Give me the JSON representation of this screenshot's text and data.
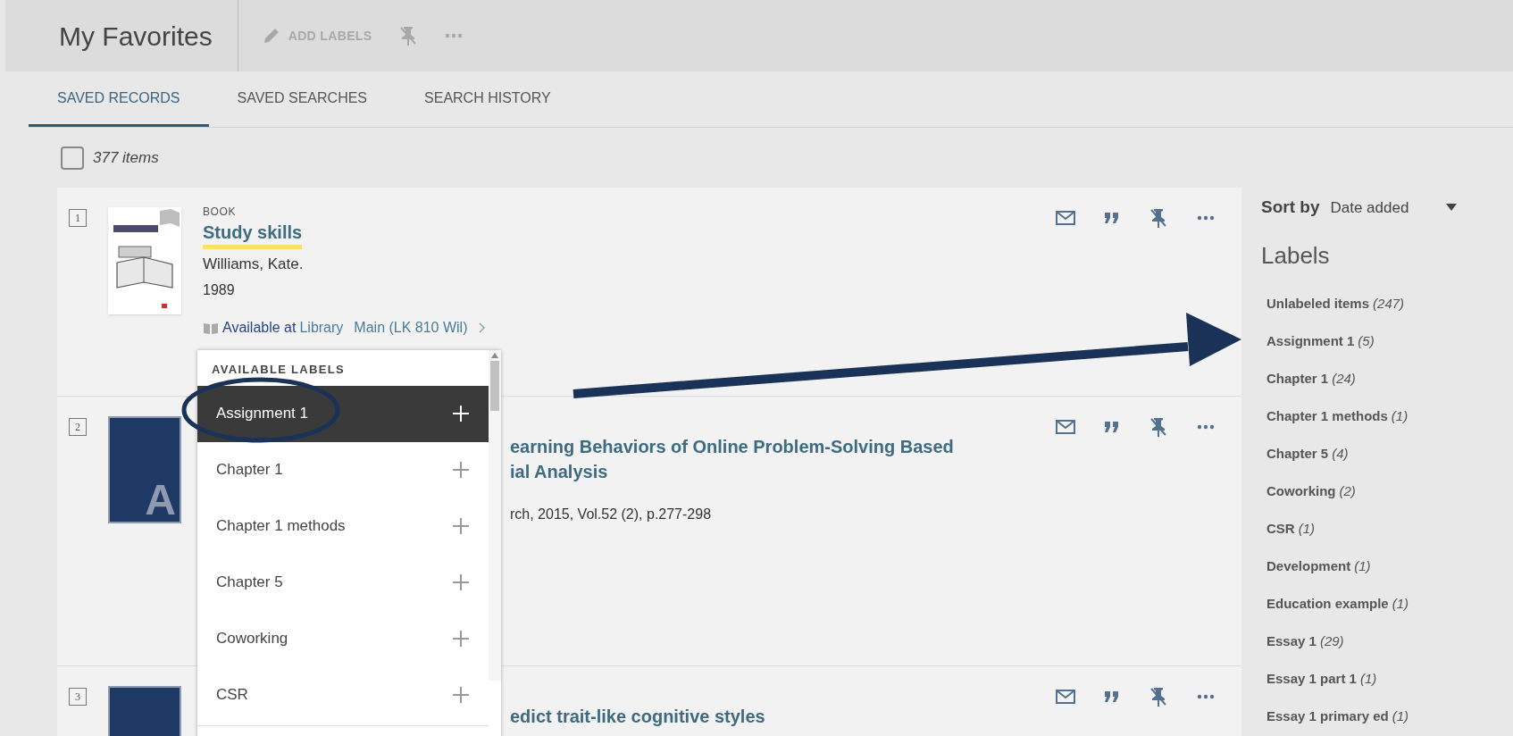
{
  "header": {
    "title": "My Favorites",
    "toolbar": [
      {
        "kind": "add_labels",
        "label": "ADD LABELS"
      },
      {
        "kind": "unpin"
      },
      {
        "kind": "more"
      }
    ]
  },
  "tabs": [
    {
      "label": "SAVED RECORDS",
      "selected": true
    },
    {
      "label": "SAVED SEARCHES",
      "selected": false
    },
    {
      "label": "SEARCH HISTORY",
      "selected": false
    }
  ],
  "select_all": {
    "checked": false,
    "label": "377 items"
  },
  "records": [
    {
      "number": "1",
      "kind": "cover",
      "type": "BOOK",
      "title_lines": [
        "Study skills"
      ],
      "highlighted": true,
      "author": "Williams, Kate.",
      "year": "1989",
      "availability": {
        "status": "Available at",
        "location": "Library",
        "sublocation": "Main (LK 810 Wil)"
      }
    },
    {
      "number": "2",
      "kind": "letter",
      "letter": "A",
      "title_lines": [
        "earning Behaviors of Online Problem-Solving Based",
        "ial Analysis"
      ],
      "highlighted": false,
      "details": "rch, 2015, Vol.52 (2), p.277-298"
    },
    {
      "number": "3",
      "kind": "plain",
      "title_lines": [
        "edict trait-like cognitive styles"
      ],
      "highlighted": false
    }
  ],
  "label_menu": {
    "heading": "AVAILABLE LABELS",
    "items": [
      {
        "label": "Assignment 1",
        "selected": true
      },
      {
        "label": "Chapter 1",
        "selected": false
      },
      {
        "label": "Chapter 1 methods",
        "selected": false
      },
      {
        "label": "Chapter 5",
        "selected": false
      },
      {
        "label": "Coworking",
        "selected": false
      },
      {
        "label": "CSR",
        "selected": false
      }
    ]
  },
  "sidebar": {
    "sort_label": "Sort by",
    "sort_value": "Date added",
    "labels_heading": "Labels",
    "labels": [
      {
        "name": "Unlabeled items",
        "count": "(247)"
      },
      {
        "name": "Assignment 1",
        "count": "(5)"
      },
      {
        "name": "Chapter 1",
        "count": "(24)"
      },
      {
        "name": "Chapter 1 methods",
        "count": "(1)"
      },
      {
        "name": "Chapter 5",
        "count": "(4)"
      },
      {
        "name": "Coworking",
        "count": "(2)"
      },
      {
        "name": "CSR",
        "count": "(1)"
      },
      {
        "name": "Development",
        "count": "(1)"
      },
      {
        "name": "Education example",
        "count": "(1)"
      },
      {
        "name": "Essay 1",
        "count": "(29)"
      },
      {
        "name": "Essay 1 part 1",
        "count": "(1)"
      },
      {
        "name": "Essay 1 primary ed",
        "count": "(1)"
      }
    ]
  }
}
